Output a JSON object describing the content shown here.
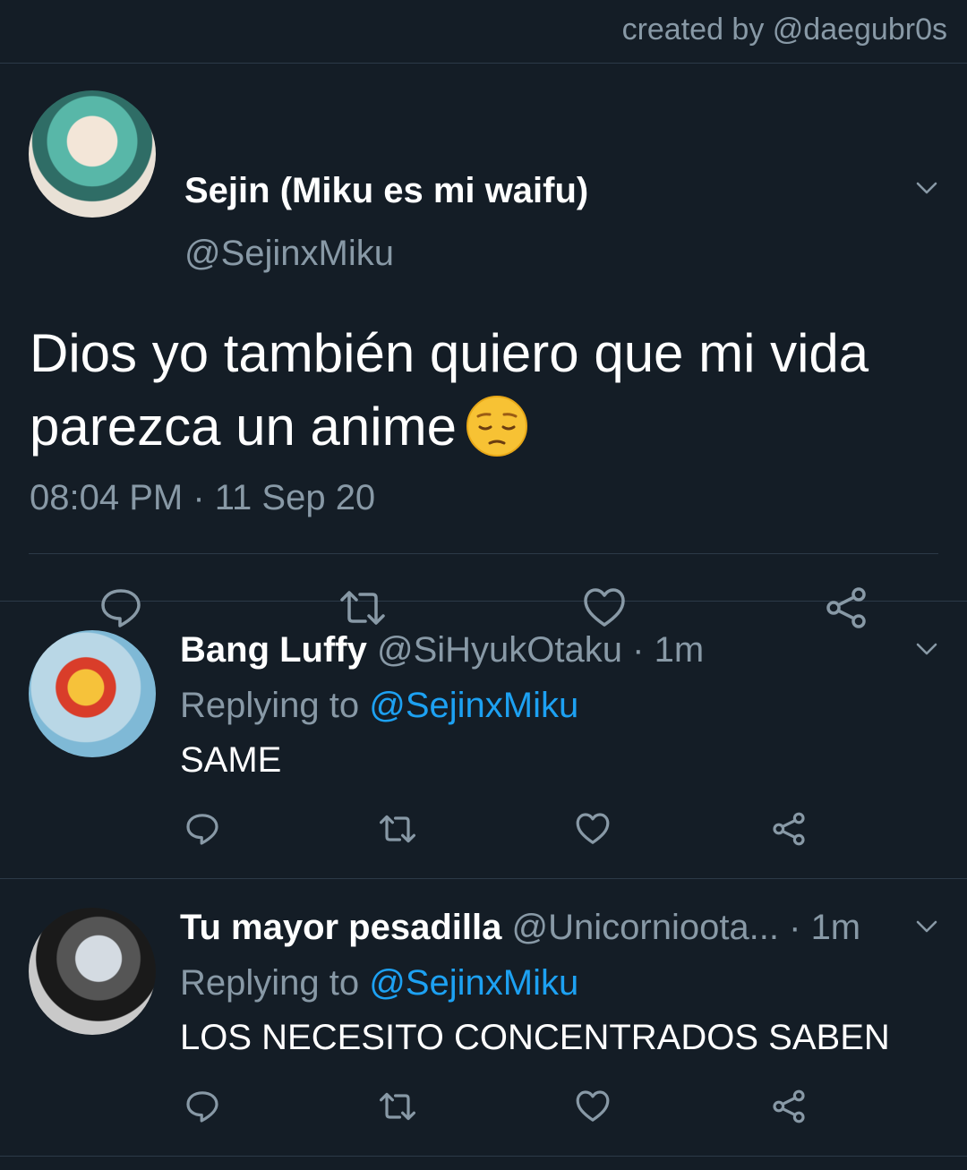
{
  "header": {
    "credit": "created by @daegubr0s"
  },
  "main_tweet": {
    "name": "Sejin (Miku es mi waifu)",
    "handle": "@SejinxMiku",
    "text": "Dios yo también quiero que mi vida parezca un anime",
    "emoji": "pensive-face",
    "time": "08:04 PM",
    "separator": " · ",
    "date": "11 Sep 20"
  },
  "replies": [
    {
      "name": "Bang Luffy",
      "handle": "@SiHyukOtaku · 1m",
      "replying_prefix": "Replying to ",
      "replying_to": "@SejinxMiku",
      "text": "SAME"
    },
    {
      "name": "Tu mayor pesadilla",
      "handle": "@Unicornioota... · 1m",
      "replying_prefix": "Replying to ",
      "replying_to": "@SejinxMiku",
      "text": "LOS NECESITO CONCENTRADOS SABEN"
    }
  ],
  "colors": {
    "background": "#141d26",
    "muted": "#8899a6",
    "accent": "#1da1f2",
    "divider": "#2c3a48"
  },
  "icons": [
    "reply-icon",
    "retweet-icon",
    "like-icon",
    "share-icon",
    "chevron-down-icon"
  ]
}
